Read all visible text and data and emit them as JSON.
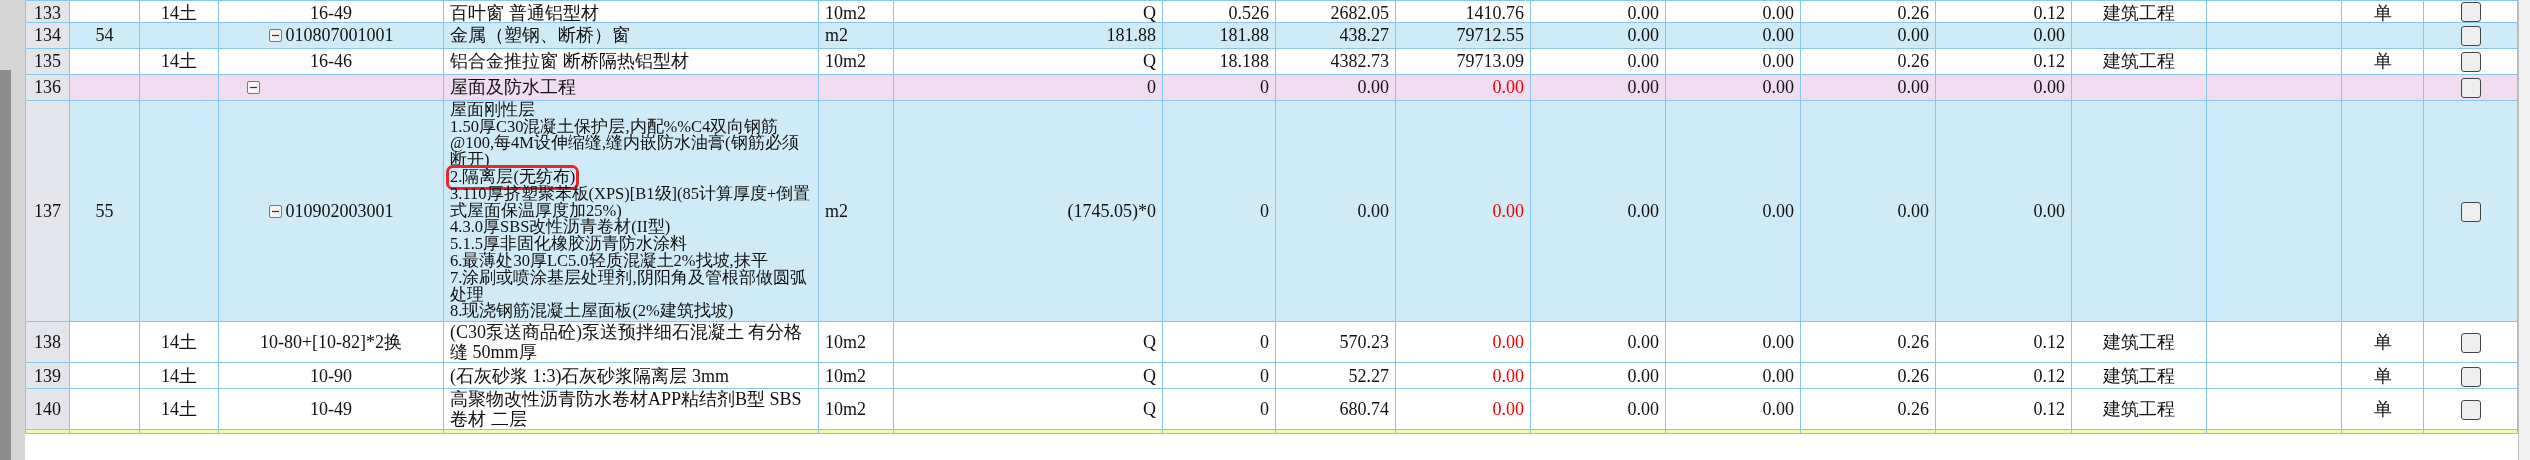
{
  "rows": [
    {
      "kind": "item",
      "cut": true,
      "number": "133",
      "column_3": "14土",
      "code": "16-49",
      "name": "百叶窗 普通铝型材",
      "unit": "10m2",
      "column_7": "Q",
      "column_8": "0.526",
      "column_9": "2682.05",
      "column_10": "1410.76",
      "total_red": false,
      "column_11": "0.00",
      "column_12": "0.00",
      "column_13": "0.26",
      "column_14": "0.12",
      "column_15": "建筑工程",
      "column_17": "单",
      "checked": false
    },
    {
      "kind": "bill",
      "number": "134",
      "column_2": "54",
      "code": "010807001001",
      "expanded": true,
      "name": "金属（塑钢、断桥）窗",
      "unit": "m2",
      "column_7": "181.88",
      "column_8": "181.88",
      "column_9": "438.27",
      "column_10": "79712.55",
      "total_red": false,
      "column_11": "0.00",
      "column_12": "0.00",
      "column_13": "0.00",
      "column_14": "0.00",
      "checked": false
    },
    {
      "kind": "item",
      "number": "135",
      "column_3": "14土",
      "code": "16-46",
      "name": "铝合金推拉窗 断桥隔热铝型材",
      "unit": "10m2",
      "column_7": "Q",
      "column_8": "18.188",
      "column_9": "4382.73",
      "column_10": "79713.09",
      "total_red": false,
      "column_11": "0.00",
      "column_12": "0.00",
      "column_13": "0.26",
      "column_14": "0.12",
      "column_15": "建筑工程",
      "column_17": "单",
      "checked": false
    },
    {
      "kind": "section",
      "number": "136",
      "expanded": true,
      "name": "屋面及防水工程",
      "column_7": "0",
      "column_8": "0",
      "column_9": "0.00",
      "column_10": "0.00",
      "total_red": true,
      "column_11": "0.00",
      "column_12": "0.00",
      "column_13": "0.00",
      "column_14": "0.00",
      "checked": false
    },
    {
      "kind": "bill",
      "number": "137",
      "column_2": "55",
      "code": "010902003001",
      "expanded": true,
      "name_lines": [
        {
          "text": "屋面刚性层",
          "highlighted": false
        },
        {
          "text": "1.50厚C30混凝土保护层,内配%%C4双向钢筋@100,每4M设伸缩缝,缝内嵌防水油膏(钢筋必须断开)",
          "highlighted": false
        },
        {
          "text": "2.隔离层(无纺布)",
          "highlighted": true
        },
        {
          "text": "3.110厚挤塑聚苯板(XPS)[B1级](85计算厚度+倒置式屋面保温厚度加25%)",
          "highlighted": false
        },
        {
          "text": "4.3.0厚SBS改性沥青卷材(II型)",
          "highlighted": false
        },
        {
          "text": "5.1.5厚非固化橡胶沥青防水涂料",
          "highlighted": false
        },
        {
          "text": "6.最薄处30厚LC5.0轻质混凝土2%找坡,抹平",
          "highlighted": false
        },
        {
          "text": "7.涂刷或喷涂基层处理剂,阴阳角及管根部做圆弧处理",
          "highlighted": false
        },
        {
          "text": "8.现浇钢筋混凝土屋面板(2%建筑找坡)",
          "highlighted": false
        }
      ],
      "unit": "m2",
      "column_7": "(1745.05)*0",
      "column_8": "0",
      "column_9": "0.00",
      "column_10": "0.00",
      "total_red": true,
      "column_11": "0.00",
      "column_12": "0.00",
      "column_13": "0.00",
      "column_14": "0.00",
      "checked": false
    },
    {
      "kind": "item",
      "number": "138",
      "column_3": "14土",
      "code": "10-80+[10-82]*2换",
      "name": "(C30泵送商品砼)泵送预拌细石混凝土 有分格缝 50mm厚",
      "unit": "10m2",
      "column_7": "Q",
      "column_8": "0",
      "column_9": "570.23",
      "column_10": "0.00",
      "total_red": true,
      "column_11": "0.00",
      "column_12": "0.00",
      "column_13": "0.26",
      "column_14": "0.12",
      "column_15": "建筑工程",
      "column_17": "单",
      "checked": false
    },
    {
      "kind": "item",
      "number": "139",
      "column_3": "14土",
      "code": "10-90",
      "name": "(石灰砂浆 1:3)石灰砂浆隔离层 3mm",
      "unit": "10m2",
      "column_7": "Q",
      "column_8": "0",
      "column_9": "52.27",
      "column_10": "0.00",
      "total_red": true,
      "column_11": "0.00",
      "column_12": "0.00",
      "column_13": "0.26",
      "column_14": "0.12",
      "column_15": "建筑工程",
      "column_17": "单",
      "checked": false
    },
    {
      "kind": "item",
      "number": "140",
      "column_3": "14土",
      "code": "10-49",
      "name": "高聚物改性沥青防水卷材APP粘结剂B型 SBS卷材 二层",
      "unit": "10m2",
      "column_7": "Q",
      "column_8": "0",
      "column_9": "680.74",
      "column_10": "0.00",
      "total_red": true,
      "column_11": "0.00",
      "column_12": "0.00",
      "column_13": "0.26",
      "column_14": "0.12",
      "column_15": "建筑工程",
      "column_17": "单",
      "checked": false
    },
    {
      "kind": "group"
    }
  ]
}
